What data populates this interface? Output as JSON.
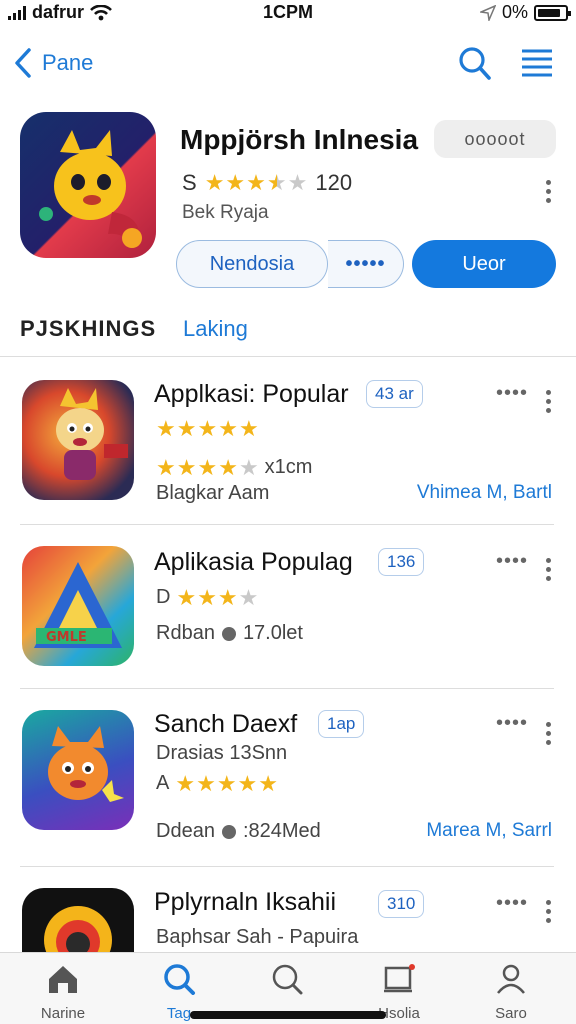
{
  "status_bar": {
    "carrier": "dafrur",
    "time": "1CPM",
    "battery": "0%"
  },
  "nav": {
    "back_label": "Pane"
  },
  "featured": {
    "title": "Mppjörsh Inlnesia",
    "pill": "ooooot",
    "rating_prefix": "S",
    "rating": 3.5,
    "rating_count": "120",
    "subtitle": "Bek Ryaja",
    "button_secondary": "Nendosia",
    "button_more": "•••••",
    "button_primary": "Ueor"
  },
  "tabs": {
    "active": "PJSKHINGS",
    "other": "Laking"
  },
  "apps": [
    {
      "title": "Applkasi: Popular",
      "badge": "43 ar",
      "line1_prefix": "",
      "line1_stars": 5,
      "line2_stars": 4,
      "line2_text": "x1cm",
      "line3_text": "Blagkar Aam",
      "link": "Vhimea M, Bartl"
    },
    {
      "title": "Aplikasia Populag",
      "badge": "136",
      "line1_prefix": "D",
      "line1_stars": 3,
      "line3_text": "Rdban",
      "line3_meta": "17.0let"
    },
    {
      "title": "Sanch Daexf",
      "badge": "1ap",
      "line1_text": "Drasias 13Snn",
      "line2_prefix": "A",
      "line2_stars": 5,
      "line3_text": "Ddean",
      "line3_meta": ":824Med",
      "link": "Marea M, Sarrl"
    },
    {
      "title": "Pplyrnaln Iksahii",
      "badge": "310",
      "line1_text": "Baphsar Sah - Papuira"
    }
  ],
  "tabbar": [
    {
      "label": "Narine",
      "icon": "home-icon"
    },
    {
      "label": "Tag",
      "icon": "search-icon",
      "active": true
    },
    {
      "label": "",
      "icon": "search-icon"
    },
    {
      "label": "Hsolia",
      "icon": "updates-icon"
    },
    {
      "label": "Saro",
      "icon": "profile-icon"
    }
  ],
  "colors": {
    "accent": "#1479de",
    "link": "#1e7ad6",
    "star": "#f3b51a"
  }
}
